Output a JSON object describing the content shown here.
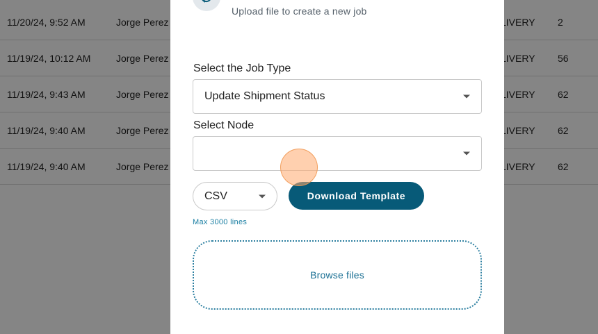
{
  "table": {
    "rows": [
      {
        "date": "11/20/24, 9:52 AM",
        "user": "Jorge Perez",
        "type": "LIVERY",
        "count": "2"
      },
      {
        "date": "11/19/24, 10:12 AM",
        "user": "Jorge Perez",
        "type": "LIVERY",
        "count": "56"
      },
      {
        "date": "11/19/24, 9:43 AM",
        "user": "Jorge Perez",
        "type": "LIVERY",
        "count": "62"
      },
      {
        "date": "11/19/24, 9:40 AM",
        "user": "Jorge Perez",
        "type": "LIVERY",
        "count": "62"
      },
      {
        "date": "11/19/24, 9:40 AM",
        "user": "Jorge Perez",
        "type": "LIVERY",
        "count": "62"
      }
    ]
  },
  "modal": {
    "icon": "upload-sync-icon",
    "subtitle": "Upload file to create a new job",
    "job_type": {
      "label": "Select the Job Type",
      "value": "Update Shipment Status"
    },
    "node": {
      "label": "Select Node",
      "value": ""
    },
    "format": {
      "value": "CSV"
    },
    "download_label": "Download Template",
    "max_lines": "Max 3000 lines",
    "browse_label": "Browse files"
  },
  "colors": {
    "primary": "#075a78",
    "link": "#1a6f93",
    "overlay": "rgba(0,0,0,0.48)"
  }
}
